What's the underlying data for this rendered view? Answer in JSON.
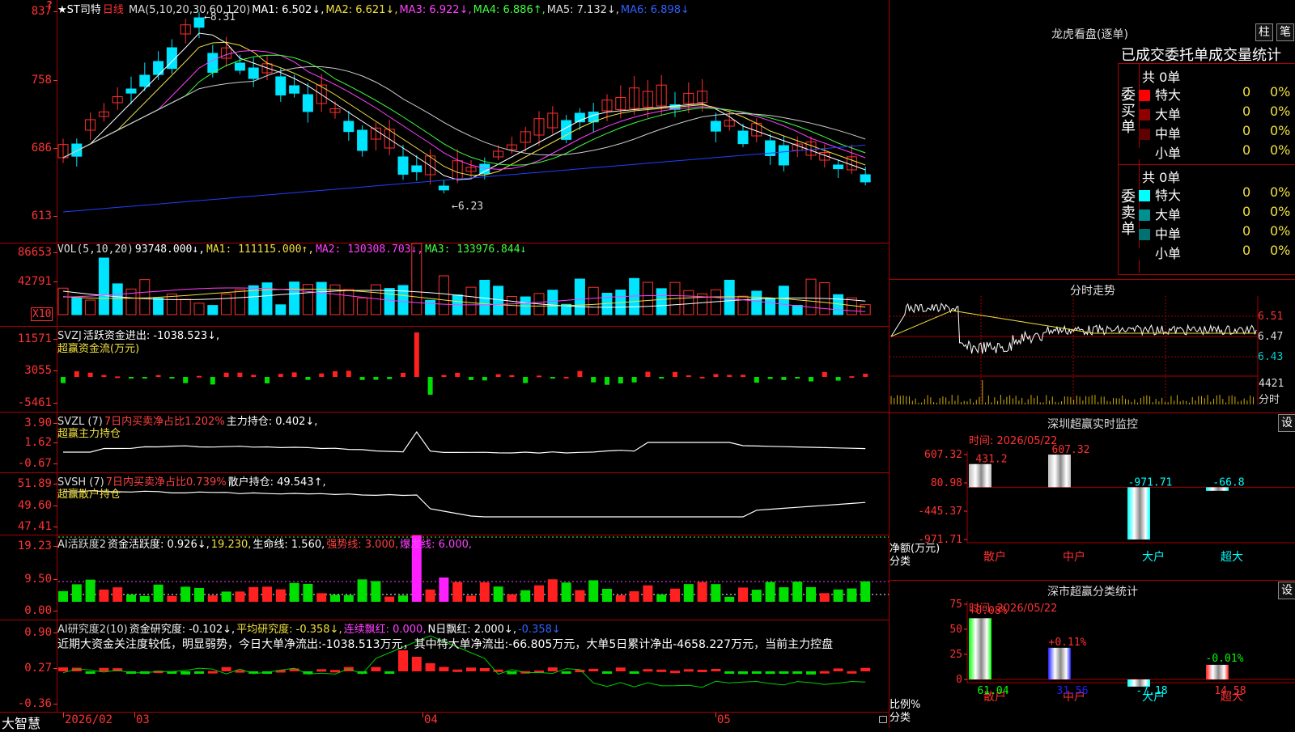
{
  "stock": {
    "title": "★ST司特",
    "period": "日线",
    "period_alert": "?"
  },
  "price_panel": {
    "ticks": [
      "837",
      "758",
      "686",
      "613"
    ],
    "ma_labels": [
      {
        "text": "MA(5,10,20,30,60,120)",
        "color": "#dddddd"
      },
      {
        "text": "MA1: 6.502↓,",
        "color": "#ffffff"
      },
      {
        "text": "MA2: 6.621↓,",
        "color": "#f0e040"
      },
      {
        "text": "MA3: 6.922↓,",
        "color": "#ff40ff"
      },
      {
        "text": "MA4: 6.886↑,",
        "color": "#40ff40"
      },
      {
        "text": "MA5: 7.132↓,",
        "color": "#dddddd"
      },
      {
        "text": "MA6: 6.898↓",
        "color": "#3060ff"
      }
    ],
    "high_label": "8.31",
    "low_label": "6.23"
  },
  "vol_panel": {
    "ticks": [
      "86653",
      "42791"
    ],
    "unit": "X10",
    "labels": [
      {
        "text": "VOL(5,10,20)",
        "color": "#dddddd"
      },
      {
        "text": "93748.000↓,",
        "color": "#ffffff"
      },
      {
        "text": "MA1: 111115.000↑,",
        "color": "#f0e040"
      },
      {
        "text": "MA2: 130308.703↓,",
        "color": "#ff40ff"
      },
      {
        "text": "MA3: 133976.844↓",
        "color": "#40ff40"
      }
    ]
  },
  "svzj_panel": {
    "ticks": [
      "11571",
      "3055",
      "-5461"
    ],
    "labels": [
      {
        "text": "SVZJ",
        "color": "#dddddd"
      },
      {
        "text": "活跃资金进出: -1038.523↓,",
        "color": "#ffffff"
      }
    ],
    "sublabel": "超赢资金流(万元)"
  },
  "svzl_panel": {
    "ticks": [
      "3.90",
      "1.62",
      "-0.67"
    ],
    "labels": [
      {
        "text": "SVZL (7)",
        "color": "#dddddd"
      },
      {
        "text": "7日内买卖净占比1.202%",
        "color": "#ff4040"
      },
      {
        "text": "主力持仓: 0.402↓,",
        "color": "#ffffff"
      }
    ],
    "sublabel": "超赢主力持仓"
  },
  "svsh_panel": {
    "ticks": [
      "51.89",
      "49.60",
      "47.41"
    ],
    "labels": [
      {
        "text": "SVSH (7)",
        "color": "#dddddd"
      },
      {
        "text": "7日内买卖净占比0.739%",
        "color": "#ff4040"
      },
      {
        "text": "散户持仓: 49.543↑,",
        "color": "#ffffff"
      }
    ],
    "sublabel": "超赢散户持仓"
  },
  "ai_active_panel": {
    "ticks": [
      "19.23",
      "9.50",
      "0.00"
    ],
    "labels": [
      {
        "text": "AI活跃度2",
        "color": "#dddddd"
      },
      {
        "text": "资金活跃度: 0.926↓,",
        "color": "#ffffff"
      },
      {
        "text": "19.230,",
        "color": "#f0e040"
      },
      {
        "text": "生命线: 1.560,",
        "color": "#ffffff"
      },
      {
        "text": "强势线: 3.000,",
        "color": "#ff4040"
      },
      {
        "text": "爆发线: 6.000,",
        "color": "#ff40ff"
      }
    ]
  },
  "ai_research_panel": {
    "ticks": [
      "0.90",
      "0.27",
      "-0.36"
    ],
    "labels": [
      {
        "text": "AI研究度2(10)",
        "color": "#dddddd"
      },
      {
        "text": "资金研究度: -0.102↓,",
        "color": "#ffffff"
      },
      {
        "text": "平均研究度: -0.358↓,",
        "color": "#f0e040"
      },
      {
        "text": "连续飘红: 0.000,",
        "color": "#ff40ff"
      },
      {
        "text": "N日飘红: 2.000↓,",
        "color": "#ffffff"
      },
      {
        "text": "-0.358↓",
        "color": "#3060ff"
      }
    ],
    "comment": "近期大资金关注度较低，明显弱势，今日大单净流出:-1038.513万元，其中特大单净流出:-66.805万元，大单5日累计净出-4658.227万元，当前主力控盘"
  },
  "bottom_bar": {
    "brand": "大智慧",
    "dates": [
      "2026/02",
      "03",
      "04",
      "05"
    ]
  },
  "longhu": {
    "title": "龙虎看盘(逐单)",
    "btn_zhu": "柱",
    "btn_bi": "笔",
    "header": "已成交委托单成交量统计",
    "buy_label": "委买单",
    "sell_label": "委卖单",
    "buy_total": "共 0单",
    "sell_total": "共 0单",
    "buy_rows": [
      {
        "name": "特大",
        "count": "0",
        "pct": "0%",
        "color": "#ff0000"
      },
      {
        "name": "大单",
        "count": "0",
        "pct": "0%",
        "color": "#900000"
      },
      {
        "name": "中单",
        "count": "0",
        "pct": "0%",
        "color": "#600000"
      },
      {
        "name": "小单",
        "count": "0",
        "pct": "0%",
        "color": "#000000"
      }
    ],
    "sell_rows": [
      {
        "name": "特大",
        "count": "0",
        "pct": "0%",
        "color": "#00ffff"
      },
      {
        "name": "大单",
        "count": "0",
        "pct": "0%",
        "color": "#009090"
      },
      {
        "name": "中单",
        "count": "0",
        "pct": "0%",
        "color": "#007070"
      },
      {
        "name": "小单",
        "count": "0",
        "pct": "0%",
        "color": "#000000"
      }
    ]
  },
  "intraday": {
    "title": "分时走势",
    "ticks": [
      "6.51",
      "6.47",
      "6.43"
    ],
    "vol_tick": "4421",
    "vol_label": "分时"
  },
  "realtime": {
    "title": "深圳超赢实时监控",
    "btn": "设",
    "time": "时间: 2026/05/22",
    "ticks": [
      "607.32",
      "80.98",
      "-445.37",
      "-971.71"
    ],
    "ylabel": "净额(万元)",
    "xlabel": "分类",
    "categories": [
      "散户",
      "中户",
      "大户",
      "超大"
    ],
    "values": [
      "431.2",
      "607.32",
      "-971.71",
      "-66.8"
    ]
  },
  "classify": {
    "title": "深市超赢分类统计",
    "btn": "设",
    "time": "时间: 2026/05/22",
    "ticks": [
      "75",
      "50",
      "25",
      "0"
    ],
    "ylabel": "比例%",
    "xlabel": "分类",
    "categories": [
      "散户",
      "中户",
      "大户",
      "超大"
    ],
    "pct_labels": [
      "+0.08%",
      "+0.11%",
      "",
      "-0.01%"
    ],
    "values": [
      "61.04",
      "31.56",
      "-7.18",
      "14.58"
    ]
  },
  "chart_data": [
    {
      "type": "bar",
      "title": "深圳超赢实时监控",
      "ylabel": "净额(万元)",
      "xlabel": "分类",
      "categories": [
        "散户",
        "中户",
        "大户",
        "超大"
      ],
      "values": [
        431.2,
        607.32,
        -971.71,
        -66.8
      ],
      "ylim": [
        -971.71,
        607.32
      ]
    },
    {
      "type": "bar",
      "title": "深市超赢分类统计",
      "ylabel": "比例%",
      "xlabel": "分类",
      "categories": [
        "散户",
        "中户",
        "大户",
        "超大"
      ],
      "values": [
        61.04,
        31.56,
        -7.18,
        14.58
      ],
      "ylim": [
        0,
        75
      ]
    }
  ]
}
